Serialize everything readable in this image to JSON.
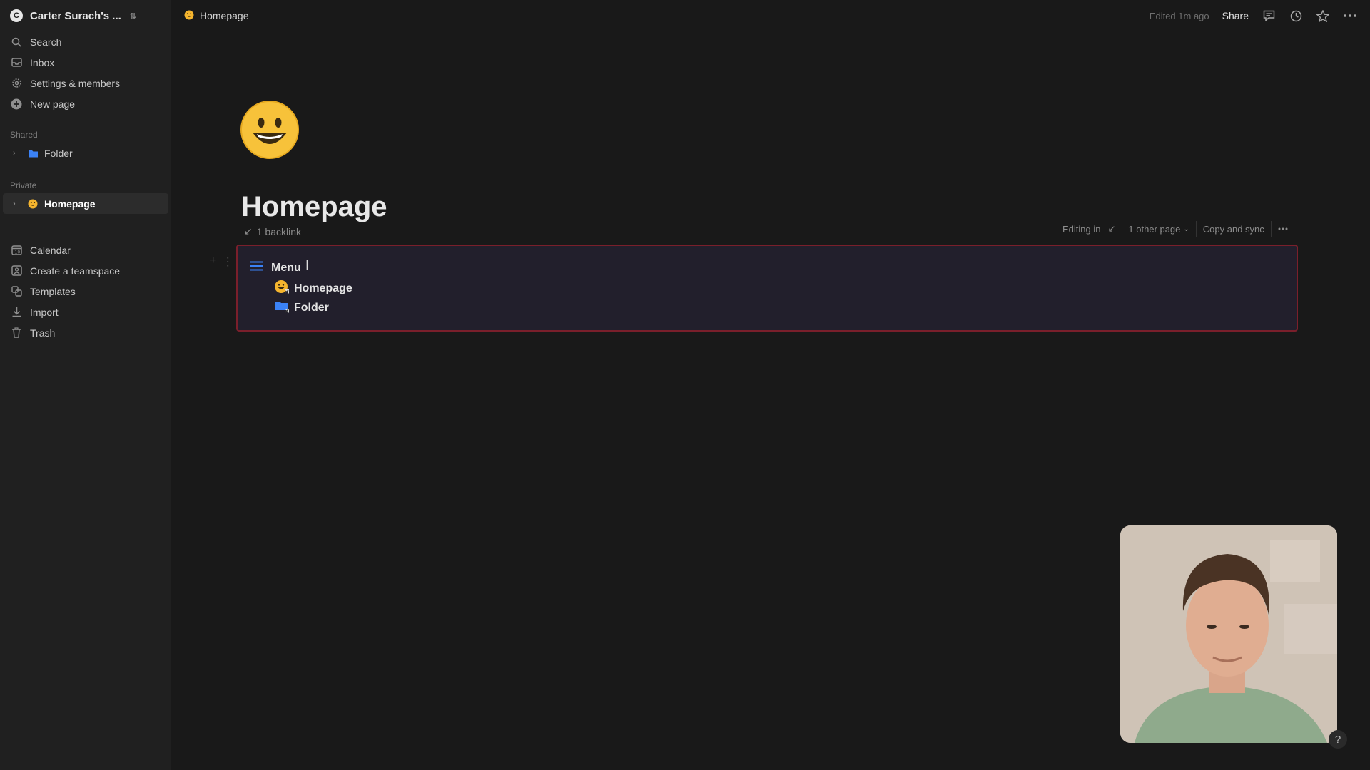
{
  "workspace": {
    "name": "Carter Surach's ..."
  },
  "sidebar": {
    "top_items": [
      {
        "label": "Search",
        "icon": "search-icon"
      },
      {
        "label": "Inbox",
        "icon": "inbox-icon"
      },
      {
        "label": "Settings & members",
        "icon": "gear-icon"
      },
      {
        "label": "New page",
        "icon": "plus-circle-icon"
      }
    ],
    "shared_label": "Shared",
    "shared_items": [
      {
        "label": "Folder",
        "icon": "folder-icon"
      }
    ],
    "private_label": "Private",
    "private_items": [
      {
        "label": "Homepage",
        "icon": "smiley-icon"
      }
    ],
    "bottom_items": [
      {
        "label": "Calendar",
        "icon": "calendar-icon"
      },
      {
        "label": "Create a teamspace",
        "icon": "teamspace-icon"
      },
      {
        "label": "Templates",
        "icon": "templates-icon"
      },
      {
        "label": "Import",
        "icon": "import-icon"
      },
      {
        "label": "Trash",
        "icon": "trash-icon"
      }
    ]
  },
  "topbar": {
    "breadcrumb": "Homepage",
    "edited": "Edited 1m ago",
    "share": "Share"
  },
  "page": {
    "title": "Homepage",
    "backlink": "1 backlink",
    "sync": {
      "editing_in": "Editing in",
      "other_page": "1 other page",
      "copy_sync": "Copy and sync"
    },
    "block": {
      "menu_label": "Menu",
      "links": [
        {
          "label": "Homepage",
          "icon": "smiley-icon"
        },
        {
          "label": "Folder",
          "icon": "folder-icon"
        }
      ]
    }
  },
  "help": "?",
  "colors": {
    "background": "#191919",
    "sidebar": "#202020",
    "sync_border": "#7a1f2b",
    "accent_blue": "#3b82f6"
  }
}
